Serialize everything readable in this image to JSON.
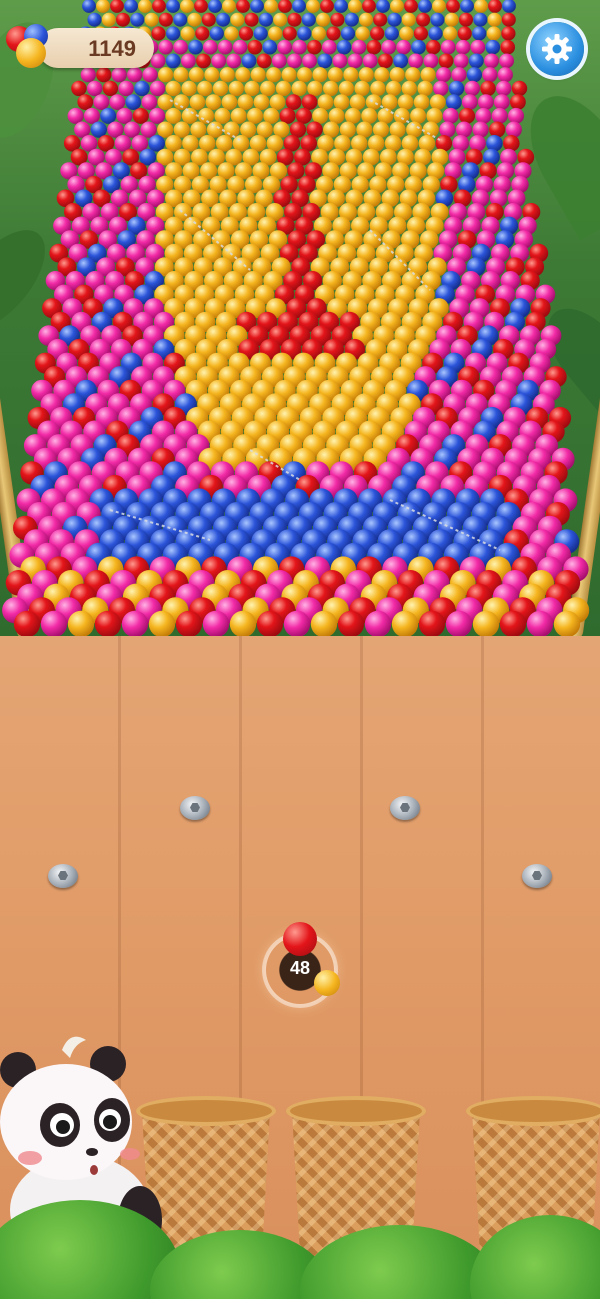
{
  "hud": {
    "score": "1149",
    "settings_icon": "gear-icon"
  },
  "shooter": {
    "shots_left": "48",
    "current_ball_color": "red",
    "next_ball_color": "yellow"
  },
  "board": {
    "colors": {
      "red": "#e3151a",
      "yellow": "#f5b51f",
      "pink": "#f22aa6",
      "blue": "#2b54d9"
    }
  },
  "mascot": "panda",
  "baskets_count": 3
}
